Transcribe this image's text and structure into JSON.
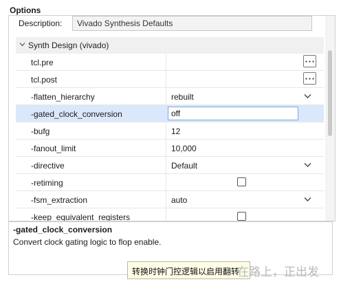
{
  "header": {
    "title": "Options"
  },
  "description": {
    "label": "Description:",
    "value": "Vivado Synthesis Defaults"
  },
  "section": {
    "label": "Synth Design (vivado)"
  },
  "rows": [
    {
      "name": "tcl.pre",
      "value": "",
      "control": "browse"
    },
    {
      "name": "tcl.post",
      "value": "",
      "control": "browse"
    },
    {
      "name": "-flatten_hierarchy",
      "value": "rebuilt",
      "control": "dropdown"
    },
    {
      "name": "-gated_clock_conversion",
      "value": "off",
      "control": "edit",
      "selected": true
    },
    {
      "name": "-bufg",
      "value": "12",
      "control": "text"
    },
    {
      "name": "-fanout_limit",
      "value": "10,000",
      "control": "text"
    },
    {
      "name": "-directive",
      "value": "Default",
      "control": "dropdown"
    },
    {
      "name": "-retiming",
      "value": "",
      "control": "checkbox",
      "checked": false
    },
    {
      "name": "-fsm_extraction",
      "value": "auto",
      "control": "dropdown"
    },
    {
      "name": "-keep_equivalent_registers",
      "value": "",
      "control": "checkbox",
      "checked": false
    }
  ],
  "help": {
    "name": "-gated_clock_conversion",
    "text": "Convert clock gating logic to flop enable."
  },
  "tooltip": {
    "text": "转换时钟门控逻辑以启用翻转"
  },
  "watermark": {
    "text": "在路上，正出发"
  },
  "icons": {
    "section_chevron": "chevron-down-icon",
    "browse": "ellipsis-icon",
    "dropdown": "chevron-down-icon"
  },
  "colors": {
    "selected_row": "#dbe8fb",
    "edit_border": "#7aa7e0",
    "tooltip_bg": "#fffde6"
  }
}
